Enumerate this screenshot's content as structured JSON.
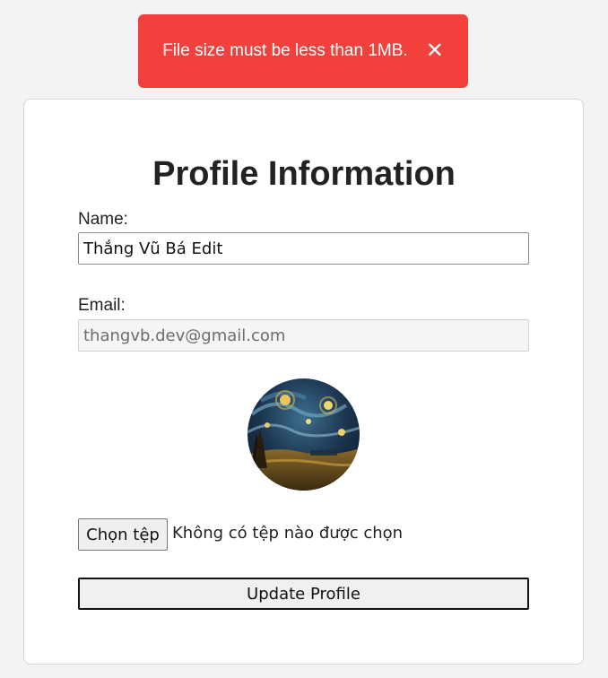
{
  "toast": {
    "message": "File size must be less than 1MB.",
    "close_label": "✕",
    "color": "#f2403c"
  },
  "form": {
    "title": "Profile Information",
    "name_label": "Name:",
    "name_value": "Thắng Vũ Bá Edit",
    "email_label": "Email:",
    "email_value": "thangvb.dev@gmail.com",
    "file_button_label": "Chọn tệp",
    "file_status": "Không có tệp nào được chọn",
    "submit_label": "Update Profile"
  },
  "avatar": {
    "icon": "starry-night-avatar-image"
  }
}
